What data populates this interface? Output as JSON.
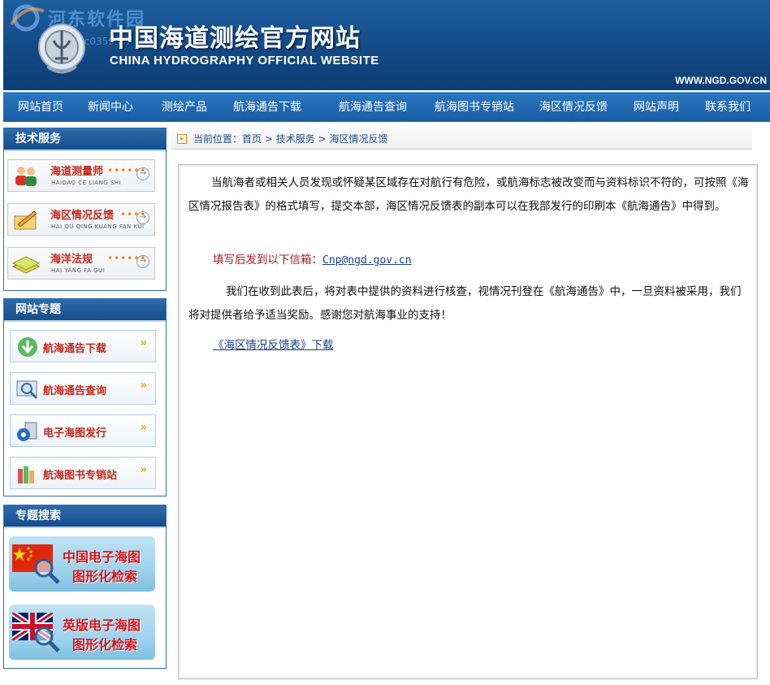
{
  "header": {
    "title_cn": "中国海道测绘官方网站",
    "title_en": "CHINA HYDROGRAPHY OFFICIAL WEBSITE",
    "site_url": "WWW.NGD.GOV.CN",
    "watermark_text": "河东软件园",
    "watermark_url": "www.pc0359.cn"
  },
  "nav": {
    "items": [
      "网站首页",
      "新闻中心",
      "测绘产品",
      "航海通告下载",
      "航海通告查询",
      "航海图书专销站",
      "海区情况反馈",
      "网站声明",
      "联系我们"
    ]
  },
  "sidebar": {
    "tech": {
      "title": "技术服务",
      "items": [
        {
          "label": "海道测量师",
          "pinyin": "HAIDAO CE LIANG SHI",
          "icon": "surveyor-icon"
        },
        {
          "label": "海区情况反馈",
          "pinyin": "HAI QU QING KUANG FAN KUI",
          "icon": "feedback-pencil-icon"
        },
        {
          "label": "海洋法规",
          "pinyin": "HAI YANG FA GUI",
          "icon": "law-book-icon"
        }
      ]
    },
    "topics": {
      "title": "网站专题",
      "items": [
        {
          "label": "航海通告下载",
          "icon": "download-arrow-icon"
        },
        {
          "label": "航海通告查询",
          "icon": "magnifier-monitor-icon"
        },
        {
          "label": "电子海图发行",
          "icon": "disc-publish-icon"
        },
        {
          "label": "航海图书专销站",
          "icon": "books-icon"
        }
      ]
    },
    "search": {
      "title": "专题搜索",
      "banners": [
        {
          "line1": "中国电子海图",
          "line2": "图形化检索",
          "flag": "china-flag-icon"
        },
        {
          "line1": "英版电子海图",
          "line2": "图形化检索",
          "flag": "uk-flag-icon"
        }
      ]
    }
  },
  "breadcrumb": {
    "prefix": "当前位置：",
    "items": [
      "首页",
      "技术服务",
      "海区情况反馈"
    ],
    "sep": ">"
  },
  "content": {
    "para1": "当航海者或相关人员发现或怀疑某区域存在对航行有危险，或航海标志被改变而与资料标识不符的，可按照《海区情况报告表》的格式填写，提交本部，海区情况反馈表的副本可以在我部发行的印刷本《航海通告》中得到。",
    "email_label": "填写后发到以下信箱：",
    "email": "Cnp@ngd.gov.cn",
    "para3": "我们在收到此表后，将对表中提供的资料进行核查，视情况刊登在《航海通告》中，一旦资料被采用，我们将对提供者给予适当奖励。感谢您对航海事业的支持！",
    "download_link": "《海区情况反馈表》下载"
  },
  "colors": {
    "header_blue": "#134a86",
    "nav_blue": "#1a5ea5",
    "accent_red": "#c4271b",
    "link_blue": "#1b3f8a"
  }
}
